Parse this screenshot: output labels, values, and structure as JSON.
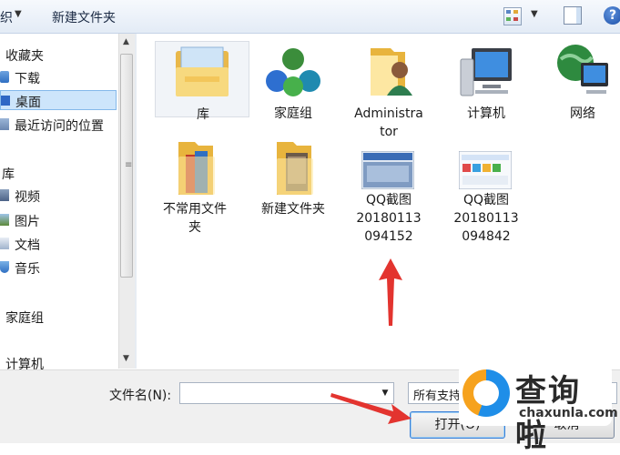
{
  "toolbar": {
    "organize_label": "织",
    "new_folder_label": "新建文件夹"
  },
  "nav": {
    "favorites_header": "收藏夹",
    "favorites": [
      {
        "label": "下载",
        "icon": "download-folder-icon"
      },
      {
        "label": "桌面",
        "icon": "desktop-icon",
        "selected": true
      },
      {
        "label": "最近访问的位置",
        "icon": "recent-places-icon"
      }
    ],
    "libraries_header": "库",
    "libraries": [
      {
        "label": "视频",
        "icon": "videos-icon"
      },
      {
        "label": "图片",
        "icon": "pictures-icon"
      },
      {
        "label": "文档",
        "icon": "documents-icon"
      },
      {
        "label": "音乐",
        "icon": "music-icon"
      }
    ],
    "homegroup_label": "家庭组",
    "computer_label": "计算机"
  },
  "items": [
    {
      "label": "库",
      "icon": "libraries-icon",
      "selected": true
    },
    {
      "label": "家庭组",
      "icon": "homegroup-icon"
    },
    {
      "label": "Administrator",
      "label2": "tor",
      "icon": "user-folder-icon",
      "display": "Administra"
    },
    {
      "label": "计算机",
      "icon": "computer-icon"
    },
    {
      "label": "网络",
      "icon": "network-icon"
    },
    {
      "label": "不常用文件",
      "label2": "夹",
      "icon": "folder-icon"
    },
    {
      "label": "新建文件夹",
      "icon": "folder-icon"
    },
    {
      "label": "QQ截图",
      "label2": "20180113",
      "label3": "094152",
      "icon": "screenshot-icon"
    },
    {
      "label": "QQ截图",
      "label2": "20180113",
      "label3": "094842",
      "icon": "screenshot-icon"
    }
  ],
  "bottom": {
    "filename_label": "文件名(N):",
    "filename_value": "",
    "filetype_value": "所有支持",
    "open_label": "打开(O)",
    "cancel_label": "取消"
  },
  "watermark": {
    "cn": "查询啦",
    "en": "chaxunla.com"
  },
  "colors": {
    "selection": "#cde5fb",
    "annotation_arrow": "#e3342f",
    "folder": "#f3c65a"
  }
}
